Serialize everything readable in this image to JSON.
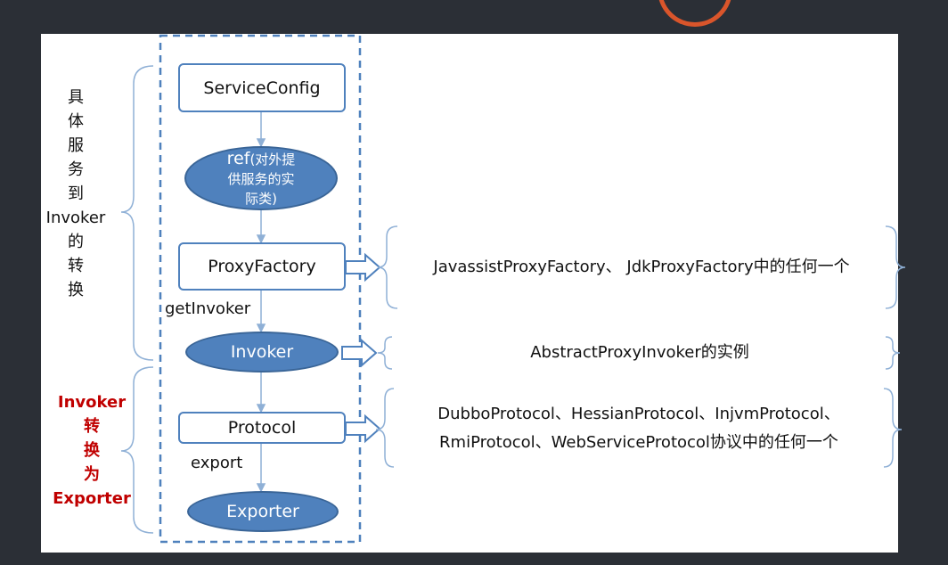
{
  "colors": {
    "background": "#2b2f36",
    "node_border": "#4f81bd",
    "node_fill": "#4f81bd",
    "red_text": "#c00000",
    "ring": "#d9552b"
  },
  "left_labels": {
    "top": [
      "具",
      "体",
      "服",
      "务",
      "到",
      "Invoker",
      "的",
      "转",
      "换"
    ],
    "bottom": [
      "Invoker",
      "转",
      "换",
      "为",
      "Exporter"
    ]
  },
  "nodes": {
    "service_config": "ServiceConfig",
    "ref_line1": "ref",
    "ref_line1_suffix": "(对外提",
    "ref_line2": "供服务的实",
    "ref_line3": "际类)",
    "proxy_factory": "ProxyFactory",
    "invoker": "Invoker",
    "protocol": "Protocol",
    "exporter": "Exporter"
  },
  "edge_labels": {
    "get_invoker": "getInvoker",
    "export": "export"
  },
  "descriptions": {
    "proxy_factory": "JavassistProxyFactory、 JdkProxyFactory中的任何一个",
    "invoker": "AbstractProxyInvoker的实例",
    "protocol_line1": "DubboProtocol、HessianProtocol、InjvmProtocol、",
    "protocol_line2": "RmiProtocol、WebServiceProtocol协议中的任何一个"
  }
}
